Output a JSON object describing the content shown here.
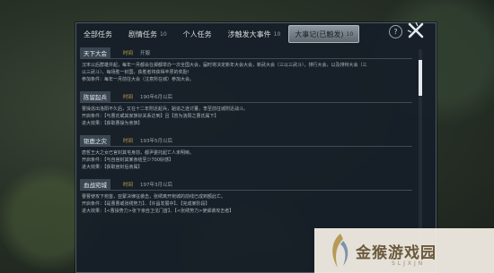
{
  "tabs": [
    {
      "label": "全部任务",
      "count": ""
    },
    {
      "label": "剧情任务",
      "count": "10"
    },
    {
      "label": "个人任务",
      "count": ""
    },
    {
      "label": "涉触发大事件",
      "count": "10"
    },
    {
      "label": "大事记(已触发)",
      "count": "10"
    }
  ],
  "help_label": "?",
  "time_label": "时间",
  "entries": [
    {
      "title": "天下大会",
      "time": "开服",
      "lines": [
        "汉末以后群雄并起，每年一月都会在邺都举办一次全国大会，届时将决定新年大会大会，新武大会（三以三武斗），排行大会，以及排辩大会（三",
        "以三武斗），每场胜一封国，获胜者将获得丰厚的奖励！",
        "参加条件：每年一月前往大会（注意所在城）参加大会。"
      ]
    },
    {
      "title": "陈留起兵",
      "time": "190年6月以后",
      "lines": [
        "曹操逃出洛阳不久后，又在十二年附近起兵，蹈追之途讨董，李至前往城附近战斗。",
        "开启条件：【与曹氏或其家族好关系达到】且【曾为洛阳之曹氏属下】",
        "进大效果：【获取曹操为亲族】"
      ]
    },
    {
      "title": "钜鹿之灾",
      "time": "193年5月以后",
      "lines": [
        "唐哲王大之女已官封其宅身前，都尹委托起亡人未明晰。",
        "开启条件：【与自宫封其某亲结至少700好感】",
        "进大效果：【获取宫封后亲属】"
      ]
    },
    {
      "title": "血战宛城",
      "time": "197年3月以后",
      "lines": [
        "曹曹使攻下宛首，亚蒙决律征袭击，张绣离开宛城的前线已成到额此亡。",
        "开启条件：【是曹曹或张绣势力】、【许昌发展中】、【完成某阶段】",
        "进大效果：【<曹操势力>张下亲自卫戈门首】、【<张绣势力>使邺袭攻击者】"
      ]
    }
  ],
  "watermark": {
    "text": "金猴游戏园",
    "sub": "SLJXJN"
  }
}
